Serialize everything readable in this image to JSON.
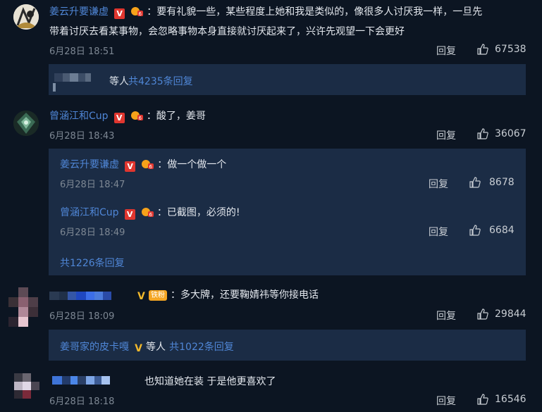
{
  "comments": [
    {
      "user": "姜云升要谦虚",
      "text": "：要有礼貌一些，某些程度上她和我是类似的，像很多人讨厌我一样，一旦先",
      "text2": "带着讨厌去看某事物，会忽略事物本身直接就讨厌起来了，兴许先观望一下会更好",
      "time": "6月28日 18:51",
      "reply_label": "回复",
      "likes": "67538",
      "sub_more_prefix": "等人",
      "sub_more_link": "共4235条回复"
    },
    {
      "user": "曾涵江和Cup",
      "text": "：酸了，姜哥",
      "time": "6月28日 18:43",
      "reply_label": "回复",
      "likes": "36067",
      "replies": [
        {
          "user": "姜云升要谦虚",
          "text": "：做一个做一个",
          "time": "6月28日 18:47",
          "reply_label": "回复",
          "likes": "8678"
        },
        {
          "user": "曾涵江和Cup",
          "text": "：已截图，必须的!",
          "time": "6月28日 18:49",
          "reply_label": "回复",
          "likes": "6684"
        }
      ],
      "more_link": "共1226条回复"
    },
    {
      "text": "：多大牌，还要鞠婧祎等你接电话",
      "badge_text": "铁粉",
      "time": "6月28日 18:09",
      "reply_label": "回复",
      "likes": "29844",
      "sub_user": "姜哥家的皮卡嘎",
      "sub_more_prefix": "等人",
      "sub_more_link": "共1022条回复"
    },
    {
      "text": "也知道她在装 于是他更喜欢了",
      "time": "6月28日 18:18",
      "reply_label": "回复",
      "likes": "16546"
    }
  ],
  "colors": {
    "background": "#0c1522",
    "panel": "#1b2c45",
    "link": "#4f86d6",
    "vip": "#e0362f"
  }
}
